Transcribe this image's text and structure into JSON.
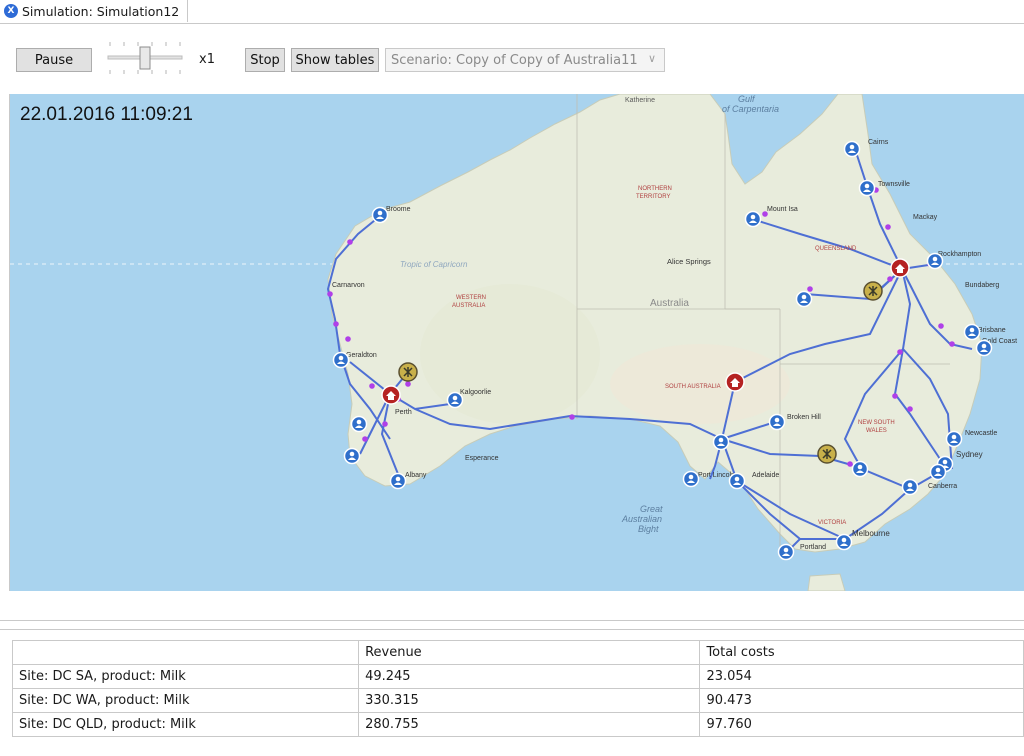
{
  "tab": {
    "title": "Simulation: Simulation12",
    "icon": "anylogistix-icon"
  },
  "toolbar": {
    "pause_label": "Pause",
    "speed_label": "x1",
    "stop_label": "Stop",
    "show_tables_label": "Show tables",
    "scenario_value": "Scenario: Copy of Copy of Australia11",
    "speed_slider_level": 0.5
  },
  "map": {
    "timestamp": "22.01.2016 11:09:21",
    "labels": {
      "gulf": "Gulf",
      "gulf2": "of Carpentaria",
      "tropic": "Tropic of Capricorn",
      "australia": "Australia",
      "bight1": "Great",
      "bight2": "Australian",
      "bight3": "Bight",
      "katherine": "Katherine",
      "alice": "Alice Springs",
      "nt1": "NORTHERN",
      "nt2": "TERRITORY",
      "wa1": "WESTERN",
      "wa2": "AUSTRALIA",
      "qld": "QUEENSLAND",
      "sa": "SOUTH AUSTRALIA",
      "nsw1": "NEW SOUTH",
      "nsw2": "WALES",
      "vic": "VICTORIA",
      "cairns": "Cairns",
      "townsville": "Townsville",
      "mackay": "Mackay",
      "rockhampton": "Rockhampton",
      "bundaberg": "Bundaberg",
      "brisbane": "Brisbane",
      "goldcoast": "Gold Coast",
      "sydney": "Sydney",
      "canberra": "Canberra",
      "melbourne": "Melbourne",
      "adelaide": "Adelaide",
      "portlincoln": "Port Lincoln",
      "brokenhill": "Broken Hill",
      "mountisa": "Mount Isa",
      "perth": "Perth",
      "kalgoorlie": "Kalgoorlie",
      "geraldton": "Geraldton",
      "broome": "Broome",
      "carnarvon": "Carnarvon",
      "esperance": "Esperance",
      "albany": "Albany",
      "newcastle": "Newcastle",
      "portland": "Portland"
    }
  },
  "table": {
    "headers": [
      "",
      "Revenue",
      "Total costs"
    ],
    "rows": [
      [
        "Site: DC SA, product: Milk",
        "49.245",
        "23.054"
      ],
      [
        "Site: DC WA, product: Milk",
        "330.315",
        "90.473"
      ],
      [
        "Site: DC QLD, product: Milk",
        "280.755",
        "97.760"
      ]
    ]
  },
  "colors": {
    "ocean": "#a9d3ee",
    "land": "#e8ecdc",
    "route": "#4e6fd4",
    "vehicle": "#b040e8",
    "customer": "#2f6fcb",
    "dc": "#b52222",
    "factory": "#c8b04a"
  }
}
